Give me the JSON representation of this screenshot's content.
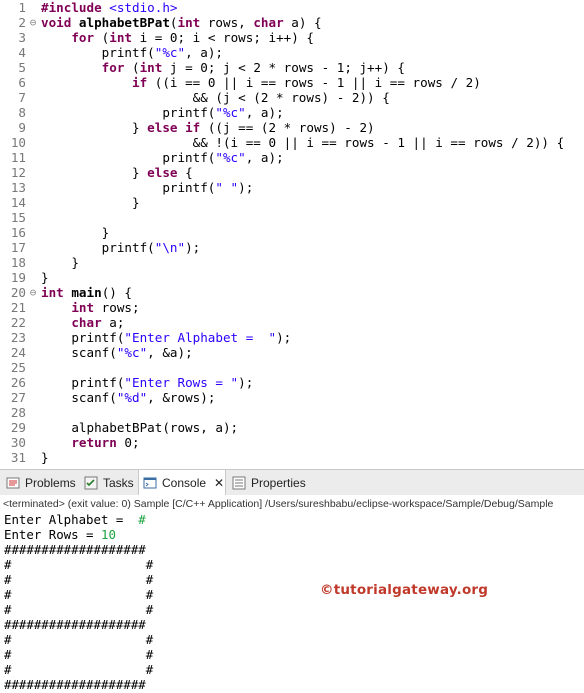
{
  "editor": {
    "lines": [
      {
        "num": "1",
        "fold": "",
        "segments": [
          {
            "t": "#include ",
            "c": "kw"
          },
          {
            "t": "<stdio.h>",
            "c": "str"
          }
        ]
      },
      {
        "num": "2",
        "fold": "⊖",
        "segments": [
          {
            "t": "void ",
            "c": "kw"
          },
          {
            "t": "alphabetBPat",
            "c": "fn"
          },
          {
            "t": "(",
            "c": ""
          },
          {
            "t": "int",
            "c": "kw"
          },
          {
            "t": " rows, ",
            "c": ""
          },
          {
            "t": "char",
            "c": "kw"
          },
          {
            "t": " a) {",
            "c": ""
          }
        ]
      },
      {
        "num": "3",
        "fold": "",
        "segments": [
          {
            "t": "    ",
            "c": ""
          },
          {
            "t": "for",
            "c": "kw"
          },
          {
            "t": " (",
            "c": ""
          },
          {
            "t": "int",
            "c": "kw"
          },
          {
            "t": " i = 0; i < rows; i++) {",
            "c": ""
          }
        ]
      },
      {
        "num": "4",
        "fold": "",
        "segments": [
          {
            "t": "        printf(",
            "c": ""
          },
          {
            "t": "\"%c\"",
            "c": "str"
          },
          {
            "t": ", a);",
            "c": ""
          }
        ]
      },
      {
        "num": "5",
        "fold": "",
        "segments": [
          {
            "t": "        ",
            "c": ""
          },
          {
            "t": "for",
            "c": "kw"
          },
          {
            "t": " (",
            "c": ""
          },
          {
            "t": "int",
            "c": "kw"
          },
          {
            "t": " j = 0; j < 2 * rows - 1; j++) {",
            "c": ""
          }
        ]
      },
      {
        "num": "6",
        "fold": "",
        "segments": [
          {
            "t": "            ",
            "c": ""
          },
          {
            "t": "if",
            "c": "kw"
          },
          {
            "t": " ((i == 0 || i == rows - 1 || i == rows / 2)",
            "c": ""
          }
        ]
      },
      {
        "num": "7",
        "fold": "",
        "segments": [
          {
            "t": "                    && (j < (2 * rows) - 2)) {",
            "c": ""
          }
        ]
      },
      {
        "num": "8",
        "fold": "",
        "segments": [
          {
            "t": "                printf(",
            "c": ""
          },
          {
            "t": "\"%c\"",
            "c": "str"
          },
          {
            "t": ", a);",
            "c": ""
          }
        ]
      },
      {
        "num": "9",
        "fold": "",
        "segments": [
          {
            "t": "            } ",
            "c": ""
          },
          {
            "t": "else if",
            "c": "kw"
          },
          {
            "t": " ((j == (2 * rows) - 2)",
            "c": ""
          }
        ]
      },
      {
        "num": "10",
        "fold": "",
        "segments": [
          {
            "t": "                    && !(i == 0 || i == rows - 1 || i == rows / 2)) {",
            "c": ""
          }
        ]
      },
      {
        "num": "11",
        "fold": "",
        "segments": [
          {
            "t": "                printf(",
            "c": ""
          },
          {
            "t": "\"%c\"",
            "c": "str"
          },
          {
            "t": ", a);",
            "c": ""
          }
        ]
      },
      {
        "num": "12",
        "fold": "",
        "segments": [
          {
            "t": "            } ",
            "c": ""
          },
          {
            "t": "else",
            "c": "kw"
          },
          {
            "t": " {",
            "c": ""
          }
        ]
      },
      {
        "num": "13",
        "fold": "",
        "segments": [
          {
            "t": "                printf(",
            "c": ""
          },
          {
            "t": "\" \"",
            "c": "str"
          },
          {
            "t": ");",
            "c": ""
          }
        ]
      },
      {
        "num": "14",
        "fold": "",
        "segments": [
          {
            "t": "            }",
            "c": ""
          }
        ]
      },
      {
        "num": "15",
        "fold": "",
        "segments": []
      },
      {
        "num": "16",
        "fold": "",
        "segments": [
          {
            "t": "        }",
            "c": ""
          }
        ]
      },
      {
        "num": "17",
        "fold": "",
        "segments": [
          {
            "t": "        printf(",
            "c": ""
          },
          {
            "t": "\"\\n\"",
            "c": "str"
          },
          {
            "t": ");",
            "c": ""
          }
        ]
      },
      {
        "num": "18",
        "fold": "",
        "segments": [
          {
            "t": "    }",
            "c": ""
          }
        ]
      },
      {
        "num": "19",
        "fold": "",
        "segments": [
          {
            "t": "}",
            "c": ""
          }
        ]
      },
      {
        "num": "20",
        "fold": "⊖",
        "segments": [
          {
            "t": "int",
            "c": "kw"
          },
          {
            "t": " ",
            "c": ""
          },
          {
            "t": "main",
            "c": "fn"
          },
          {
            "t": "() {",
            "c": ""
          }
        ]
      },
      {
        "num": "21",
        "fold": "",
        "segments": [
          {
            "t": "    ",
            "c": ""
          },
          {
            "t": "int",
            "c": "kw"
          },
          {
            "t": " rows;",
            "c": ""
          }
        ]
      },
      {
        "num": "22",
        "fold": "",
        "segments": [
          {
            "t": "    ",
            "c": ""
          },
          {
            "t": "char",
            "c": "kw"
          },
          {
            "t": " a;",
            "c": ""
          }
        ]
      },
      {
        "num": "23",
        "fold": "",
        "segments": [
          {
            "t": "    printf(",
            "c": ""
          },
          {
            "t": "\"Enter Alphabet =  \"",
            "c": "str"
          },
          {
            "t": ");",
            "c": ""
          }
        ]
      },
      {
        "num": "24",
        "fold": "",
        "segments": [
          {
            "t": "    scanf(",
            "c": ""
          },
          {
            "t": "\"%c\"",
            "c": "str"
          },
          {
            "t": ", &a);",
            "c": ""
          }
        ]
      },
      {
        "num": "25",
        "fold": "",
        "segments": []
      },
      {
        "num": "26",
        "fold": "",
        "segments": [
          {
            "t": "    printf(",
            "c": ""
          },
          {
            "t": "\"Enter Rows = \"",
            "c": "str"
          },
          {
            "t": ");",
            "c": ""
          }
        ]
      },
      {
        "num": "27",
        "fold": "",
        "segments": [
          {
            "t": "    scanf(",
            "c": ""
          },
          {
            "t": "\"%d\"",
            "c": "str"
          },
          {
            "t": ", &rows);",
            "c": ""
          }
        ]
      },
      {
        "num": "28",
        "fold": "",
        "segments": []
      },
      {
        "num": "29",
        "fold": "",
        "segments": [
          {
            "t": "    alphabetBPat(rows, a);",
            "c": ""
          }
        ]
      },
      {
        "num": "30",
        "fold": "",
        "segments": [
          {
            "t": "    ",
            "c": ""
          },
          {
            "t": "return",
            "c": "kw"
          },
          {
            "t": " 0;",
            "c": ""
          }
        ]
      },
      {
        "num": "31",
        "fold": "",
        "segments": [
          {
            "t": "}",
            "c": ""
          }
        ]
      }
    ]
  },
  "views": {
    "tabs": [
      {
        "label": "Problems",
        "icon": "problems-icon",
        "active": false
      },
      {
        "label": "Tasks",
        "icon": "tasks-icon",
        "active": false
      },
      {
        "label": "Console",
        "icon": "console-icon",
        "active": true,
        "close": "✕"
      },
      {
        "label": "Properties",
        "icon": "properties-icon",
        "active": false
      }
    ]
  },
  "console": {
    "status": "<terminated> (exit value: 0) Sample [C/C++ Application] /Users/sureshbabu/eclipse-workspace/Sample/Debug/Sample",
    "prompt_alphabet": "Enter Alphabet =  ",
    "input_alphabet": "#",
    "prompt_rows": "Enter Rows = ",
    "input_rows": "10",
    "output_lines": [
      "###################",
      "#                  #",
      "#                  #",
      "#                  #",
      "#                  #",
      "###################",
      "#                  #",
      "#                  #",
      "#                  #",
      "###################"
    ]
  },
  "watermark": "©tutorialgateway.org",
  "colors": {
    "keyword": "#7f0055",
    "string": "#2a00ff",
    "line_number": "#787878",
    "console_input": "#19a33e",
    "watermark": "#c0392b"
  }
}
